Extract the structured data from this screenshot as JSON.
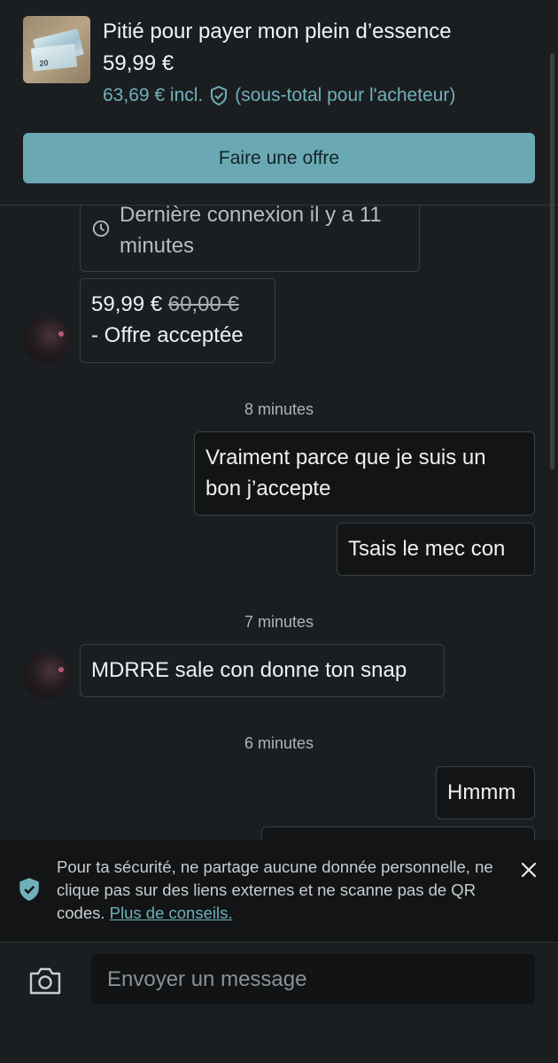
{
  "header": {
    "item_title": "Pitié pour payer mon plein d’essence",
    "item_price": "59,99 €",
    "incl_price": "63,69 € incl.",
    "incl_note": "(sous-total pour l'acheteur)",
    "thumb_note_value": "20",
    "offer_button": "Faire une offre"
  },
  "chat": {
    "status_text": "Dernière connexion il y a 11 minutes",
    "offer": {
      "new_price": "59,99 €",
      "old_price": "60,00 €",
      "status": "- Offre acceptée"
    },
    "time_1": "8 minutes",
    "msg_out_1": "Vraiment parce que je suis un bon j’accepte",
    "msg_out_2": "Tsais le mec con",
    "time_2": "7 minutes",
    "msg_in_1": "MDRRE sale con donne ton snap",
    "time_3": "6 minutes",
    "msg_out_3": "Hmmm"
  },
  "banner": {
    "text": "Pour ta sécurité, ne partage aucune donnée personnelle, ne clique pas sur des liens externes et ne scanne pas de QR codes.",
    "link": "Plus de conseils."
  },
  "composer": {
    "placeholder": "Envoyer un message"
  },
  "colors": {
    "accent": "#6aa9b4",
    "link": "#6fb0bb",
    "background": "#1b1e20"
  }
}
